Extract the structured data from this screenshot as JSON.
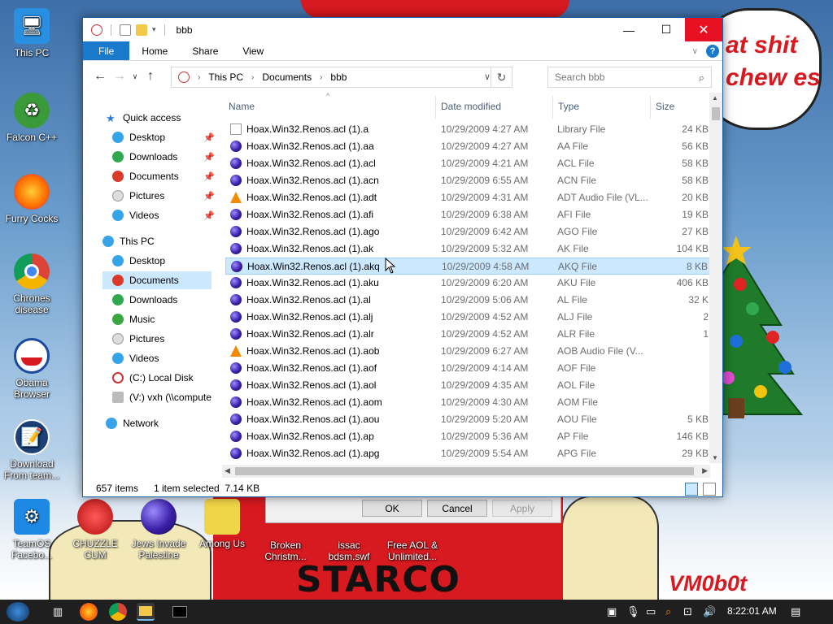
{
  "window": {
    "title": "bbb",
    "tabs": [
      "File",
      "Home",
      "Share",
      "View"
    ],
    "breadcrumb": [
      "This PC",
      "Documents",
      "bbb"
    ],
    "search_placeholder": "Search bbb",
    "columns": {
      "name": "Name",
      "date": "Date modified",
      "type": "Type",
      "size": "Size"
    }
  },
  "nav": {
    "quick_access": "Quick access",
    "quick_items": [
      "Desktop",
      "Downloads",
      "Documents",
      "Pictures",
      "Videos"
    ],
    "this_pc": "This PC",
    "pc_items": [
      "Desktop",
      "Documents",
      "Downloads",
      "Music",
      "Pictures",
      "Videos",
      "(C:) Local Disk",
      "(V:) vxh (\\\\compute"
    ],
    "network": "Network"
  },
  "files": [
    {
      "name": "Hoax.Win32.Renos.acl (1).a",
      "date": "10/29/2009 4:27 AM",
      "type": "Library File",
      "size": "24 KB",
      "icon": "doc"
    },
    {
      "name": "Hoax.Win32.Renos.acl (1).aa",
      "date": "10/29/2009 4:27 AM",
      "type": "AA File",
      "size": "56 KB",
      "icon": "orb"
    },
    {
      "name": "Hoax.Win32.Renos.acl (1).acl",
      "date": "10/29/2009 4:21 AM",
      "type": "ACL File",
      "size": "58 KB",
      "icon": "orb"
    },
    {
      "name": "Hoax.Win32.Renos.acl (1).acn",
      "date": "10/29/2009 6:55 AM",
      "type": "ACN File",
      "size": "58 KB",
      "icon": "orb"
    },
    {
      "name": "Hoax.Win32.Renos.acl (1).adt",
      "date": "10/29/2009 4:31 AM",
      "type": "ADT Audio File (VL...",
      "size": "20 KB",
      "icon": "cone"
    },
    {
      "name": "Hoax.Win32.Renos.acl (1).afi",
      "date": "10/29/2009 6:38 AM",
      "type": "AFI File",
      "size": "19 KB",
      "icon": "orb"
    },
    {
      "name": "Hoax.Win32.Renos.acl (1).ago",
      "date": "10/29/2009 6:42 AM",
      "type": "AGO File",
      "size": "27 KB",
      "icon": "orb"
    },
    {
      "name": "Hoax.Win32.Renos.acl (1).ak",
      "date": "10/29/2009 5:32 AM",
      "type": "AK File",
      "size": "104 KB",
      "icon": "orb"
    },
    {
      "name": "Hoax.Win32.Renos.acl (1).akq",
      "date": "10/29/2009 4:58 AM",
      "type": "AKQ File",
      "size": "8 KB",
      "icon": "orb"
    },
    {
      "name": "Hoax.Win32.Renos.acl (1).aku",
      "date": "10/29/2009 6:20 AM",
      "type": "AKU File",
      "size": "406 KB",
      "icon": "orb"
    },
    {
      "name": "Hoax.Win32.Renos.acl (1).al",
      "date": "10/29/2009 5:06 AM",
      "type": "AL File",
      "size": "32 K",
      "icon": "orb"
    },
    {
      "name": "Hoax.Win32.Renos.acl (1).alj",
      "date": "10/29/2009 4:52 AM",
      "type": "ALJ File",
      "size": "2",
      "icon": "orb"
    },
    {
      "name": "Hoax.Win32.Renos.acl (1).alr",
      "date": "10/29/2009 4:52 AM",
      "type": "ALR File",
      "size": "1",
      "icon": "orb"
    },
    {
      "name": "Hoax.Win32.Renos.acl (1).aob",
      "date": "10/29/2009 6:27 AM",
      "type": "AOB Audio File (V...",
      "size": "",
      "icon": "cone"
    },
    {
      "name": "Hoax.Win32.Renos.acl (1).aof",
      "date": "10/29/2009 4:14 AM",
      "type": "AOF File",
      "size": "",
      "icon": "orb"
    },
    {
      "name": "Hoax.Win32.Renos.acl (1).aol",
      "date": "10/29/2009 4:35 AM",
      "type": "AOL File",
      "size": "",
      "icon": "orb"
    },
    {
      "name": "Hoax.Win32.Renos.acl (1).aom",
      "date": "10/29/2009 4:30 AM",
      "type": "AOM File",
      "size": "",
      "icon": "orb"
    },
    {
      "name": "Hoax.Win32.Renos.acl (1).aou",
      "date": "10/29/2009 5:20 AM",
      "type": "AOU File",
      "size": "5 KB",
      "icon": "orb"
    },
    {
      "name": "Hoax.Win32.Renos.acl (1).ap",
      "date": "10/29/2009 5:36 AM",
      "type": "AP File",
      "size": "146 KB",
      "icon": "orb"
    },
    {
      "name": "Hoax.Win32.Renos.acl (1).apg",
      "date": "10/29/2009 5:54 AM",
      "type": "APG File",
      "size": "29 KB",
      "icon": "orb"
    }
  ],
  "selected_index": 8,
  "status": {
    "count": "657 items",
    "selection": "1 item selected  7.14 KB"
  },
  "dialog": {
    "ok": "OK",
    "cancel": "Cancel",
    "apply": "Apply"
  },
  "desktop_icons": [
    {
      "label": "This PC",
      "icon": "monitor-icon"
    },
    {
      "label": "Falcon C++",
      "icon": "recycle-icon"
    },
    {
      "label": "Furry Cocks",
      "icon": "firefox-icon"
    },
    {
      "label": "Chrones disease",
      "icon": "chrome-icon"
    },
    {
      "label": "Obama Browser",
      "icon": "obama-logo-icon"
    },
    {
      "label": "Download From team...",
      "icon": "document-icon"
    },
    {
      "label": "TeamOS Facebo...",
      "icon": "gear-icon"
    },
    {
      "label": "CHUZZLE CUM",
      "icon": "chuzzle-icon"
    },
    {
      "label": "Jews Invade Palestine",
      "icon": "orb-icon"
    },
    {
      "label": "Among Us",
      "icon": "among-us-icon"
    },
    {
      "label": "Broken Christm...",
      "icon": "file-icon"
    },
    {
      "label": "issac bdsm.swf",
      "icon": "swf-icon"
    },
    {
      "label": "Free AOL & Unlimited...",
      "icon": "aol-icon"
    }
  ],
  "background_text": {
    "bubble": "at shit chew es",
    "banner": "STARCO",
    "signature": "VM0b0t"
  },
  "clock": "8:22:01 AM"
}
